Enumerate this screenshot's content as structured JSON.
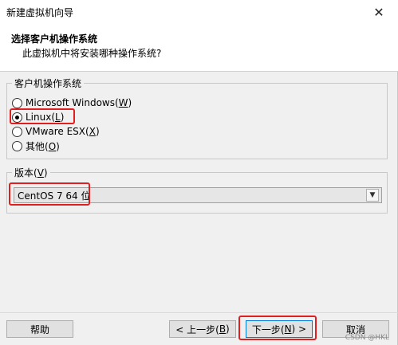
{
  "window": {
    "title": "新建虚拟机向导",
    "close_glyph": "✕"
  },
  "header": {
    "title": "选择客户机操作系统",
    "subtitle": "此虚拟机中将安装哪种操作系统?"
  },
  "os_group": {
    "legend": "客户机操作系统",
    "options": [
      {
        "label": "Microsoft Windows(",
        "key": "W",
        "suffix": ")",
        "checked": false
      },
      {
        "label": "Linux(",
        "key": "L",
        "suffix": ")",
        "checked": true
      },
      {
        "label": "VMware ESX(",
        "key": "X",
        "suffix": ")",
        "checked": false
      },
      {
        "label": "其他(",
        "key": "O",
        "suffix": ")",
        "checked": false
      }
    ]
  },
  "version_group": {
    "legend_prefix": "版本(",
    "legend_key": "V",
    "legend_suffix": ")",
    "selected": "CentOS 7 64 位"
  },
  "buttons": {
    "help": "帮助",
    "back_prefix": "< 上一步(",
    "back_key": "B",
    "back_suffix": ")",
    "next_prefix": "下一步(",
    "next_key": "N",
    "next_suffix": ") >",
    "cancel": "取消"
  },
  "watermark": "CSDN @HKL",
  "colors": {
    "highlight": "#e02020",
    "next_button_border": "#0078d7"
  }
}
